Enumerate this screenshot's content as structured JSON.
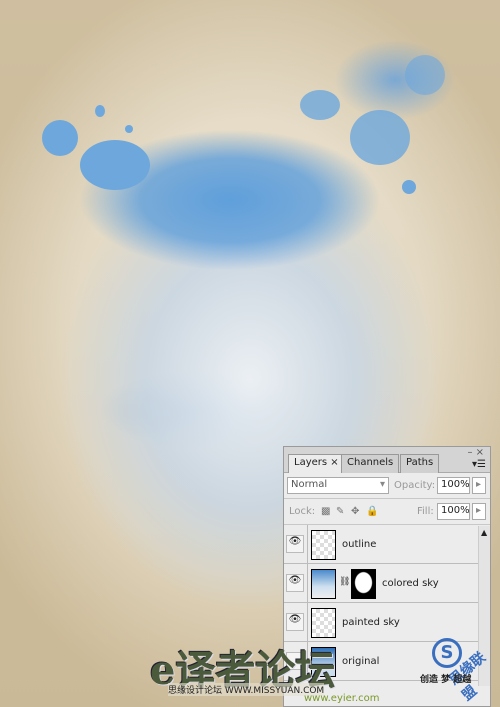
{
  "panel": {
    "tabs": [
      {
        "label": "Layers ×"
      },
      {
        "label": "Channels"
      },
      {
        "label": "Paths"
      }
    ],
    "window_controls": "– ×",
    "blend_mode": "Normal",
    "opacity_label": "Opacity:",
    "opacity_value": "100%",
    "lock_label": "Lock:",
    "fill_label": "Fill:",
    "fill_value": "100%",
    "layers": [
      {
        "name": "outline",
        "visible": true
      },
      {
        "name": "colored sky",
        "visible": true,
        "has_mask": true
      },
      {
        "name": "painted sky",
        "visible": true
      },
      {
        "name": "original",
        "visible": false
      }
    ]
  },
  "watermarks": {
    "calligraphy": "e译者论坛",
    "missyuan": "思缘设计论坛 WWW.MISSYUAN.COM",
    "eyier": "www.eyier.com",
    "logo": "思缘联盟",
    "slogan": "创造 梦 超越"
  }
}
